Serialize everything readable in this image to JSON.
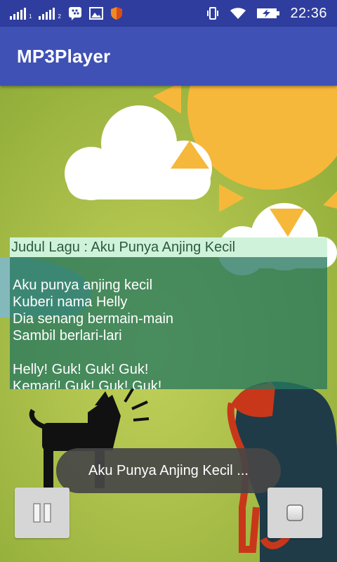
{
  "status_bar": {
    "sim1_label": "1",
    "sim2_label": "2",
    "time": "22:36",
    "icons": [
      "signal-icon",
      "bbm-icon",
      "image-icon",
      "shield-icon",
      "vibrate-icon",
      "wifi-icon",
      "battery-charging-icon"
    ]
  },
  "app_bar": {
    "title": "MP3Player"
  },
  "lyrics": {
    "title": "Judul Lagu : Aku Punya Anjing Kecil",
    "lines": [
      "",
      "Aku punya anjing kecil",
      "Kuberi nama Helly",
      "Dia senang bermain-main",
      "Sambil berlari-lari",
      "",
      "Helly! Guk! Guk! Guk!",
      "Kemari! Guk! Guk! Guk!"
    ]
  },
  "toast": {
    "text": "Aku Punya Anjing Kecil ..."
  },
  "controls": {
    "pause_icon": "pause-icon",
    "stop_icon": "stop-icon"
  },
  "colors": {
    "status_bar": "#2f3e9e",
    "app_bar": "#3f51b5",
    "background_green": "#a8bf3c",
    "sun": "#f6b83a",
    "lyrics_panel": "#28785f",
    "lyrics_title_bg": "#cff3da"
  }
}
